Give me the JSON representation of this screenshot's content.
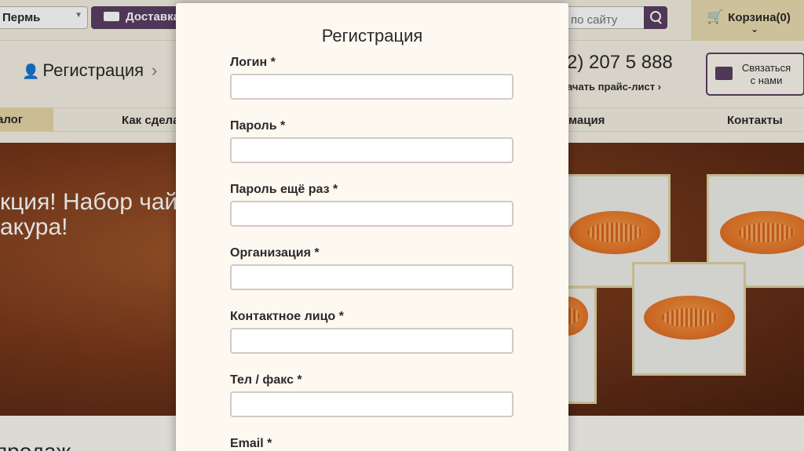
{
  "topbar": {
    "city": "Пермь",
    "delivery_label": "Доставка",
    "search_placeholder": "по сайту",
    "cart_label": "Корзина(0)"
  },
  "header": {
    "registration_label": "Регистрация",
    "phone": "2) 207 5 888",
    "price_list": "ачать прайс-лист ›",
    "contact_button": "Связаться\nс нами"
  },
  "nav": {
    "items": [
      "алог",
      "Как сдела",
      "мация",
      "Контакты"
    ]
  },
  "banner": {
    "text": "кция! Набор чай\nакура!"
  },
  "below": {
    "text": "продаж"
  },
  "modal": {
    "title": "Регистрация",
    "fields": [
      {
        "label": "Логин *",
        "value": ""
      },
      {
        "label": "Пароль *",
        "value": ""
      },
      {
        "label": "Пароль ещё раз *",
        "value": ""
      },
      {
        "label": "Организация *",
        "value": ""
      },
      {
        "label": "Контактное лицо *",
        "value": ""
      },
      {
        "label": "Тел / факс *",
        "value": ""
      },
      {
        "label": "Email *",
        "value": ""
      }
    ]
  }
}
